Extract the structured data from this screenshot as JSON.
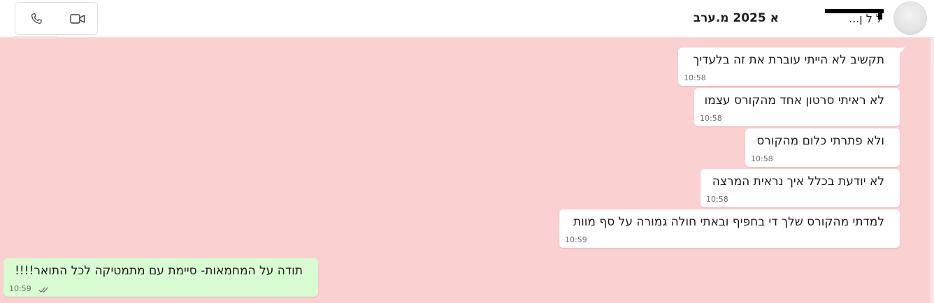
{
  "header": {
    "title": "א 2025 מ.ערב",
    "subtitle": "ל ל ן...",
    "voice_call_icon": "phone-icon",
    "video_call_icon": "video-camera-icon",
    "avatar_icon": "avatar"
  },
  "colors": {
    "chat_background": "#fbd0d1",
    "outgoing_bubble": "#ffffff",
    "incoming_bubble": "#d9fdd3",
    "read_check": "#6b6b6b"
  },
  "messages": [
    {
      "text": "תקשיב לא הייתי עוברת את זה בלעדיך",
      "time": "10:58"
    },
    {
      "text": "לא ראיתי סרטון אחד מהקורס עצמו",
      "time": "10:58"
    },
    {
      "text": "ולא פתרתי כלום מהקורס",
      "time": "10:58"
    },
    {
      "text": "לא יודעת בכלל איך נראית המרצה",
      "time": "10:58"
    },
    {
      "text": "למדתי מהקורס שלך די בחפיף ובאתי חולה גמורה על סף מוות",
      "time": "10:59"
    },
    {
      "text": "תודה על המחמאות- סיימת עם מתמטיקה לכל התואר!!!!",
      "time": "10:59",
      "status_icon": "double-check-icon"
    }
  ]
}
